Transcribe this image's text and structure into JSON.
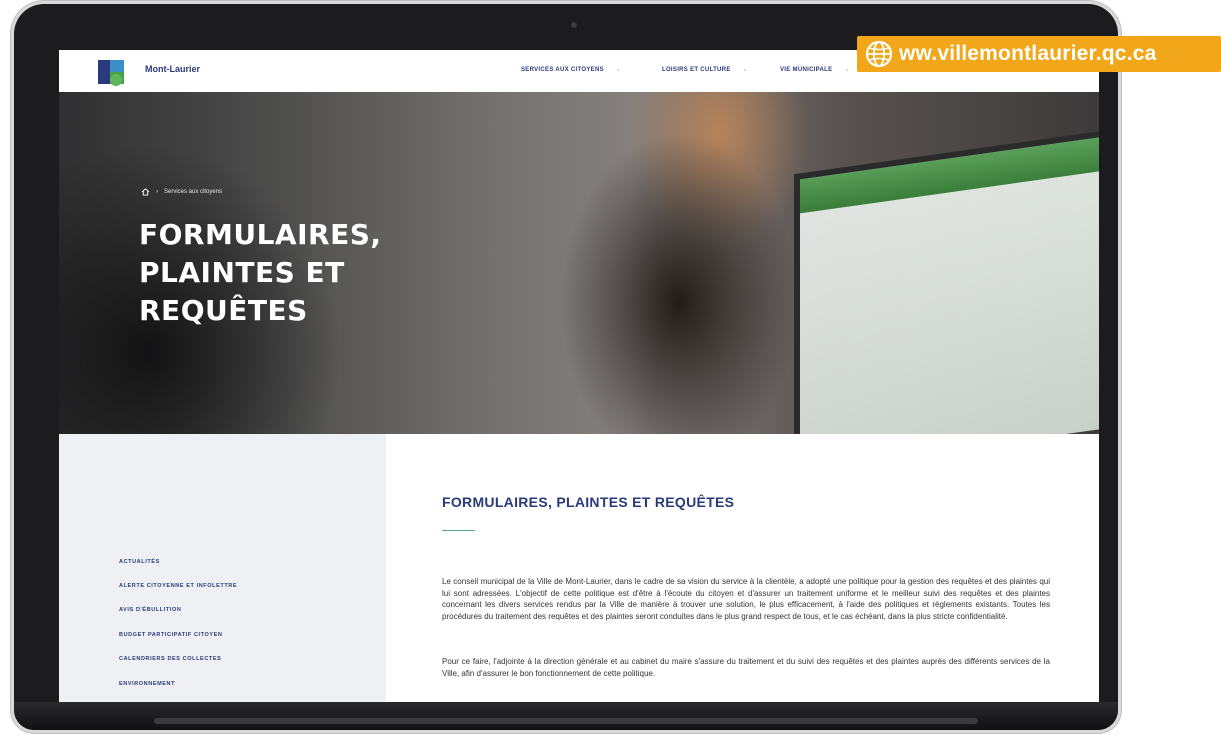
{
  "url_badge": {
    "text": "ww.villemontlaurier.qc.ca"
  },
  "site": {
    "brand": "Mont-Laurier",
    "nav": [
      {
        "label": "SERVICES AUX CITOYENS"
      },
      {
        "label": "LOISIRS ET CULTURE"
      },
      {
        "label": "VIE MUNICIPALE"
      }
    ]
  },
  "hero": {
    "breadcrumb": "Services aux citoyens",
    "title_lines": [
      "FORMULAIRES,",
      "PLAINTES ET",
      "REQUÊTES"
    ]
  },
  "sidebar": {
    "items": [
      {
        "label": "ACTUALITÉS"
      },
      {
        "label": "ALERTE CITOYENNE ET INFOLETTRE"
      },
      {
        "label": "AVIS D'ÉBULLITION"
      },
      {
        "label": "BUDGET PARTICIPATIF CITOYEN"
      },
      {
        "label": "CALENDRIERS DES COLLECTES"
      },
      {
        "label": "ENVIRONNEMENT"
      }
    ]
  },
  "content": {
    "title": "FORMULAIRES, PLAINTES ET REQUÊTES",
    "paragraphs": [
      "Le conseil municipal de la Ville de Mont-Laurier, dans le cadre de sa vision du service à la clientèle, a adopté une politique pour la gestion des requêtes et des plaintes qui lui sont adressées. L'objectif de cette politique est d'être à l'écoute du citoyen et d'assurer un traitement uniforme et le meilleur suivi des requêtes et des plaintes concernant les divers services rendus par la Ville de manière à trouver une solution, le plus efficacement, à l'aide des politiques et règlements existants. Toutes les procédures du traitement des requêtes et des plaintes seront conduites dans le plus grand respect de tous, et le cas échéant, dans la plus stricte confidentialité.",
      "Pour ce faire, l'adjointe à la direction générale et au cabinet du maire s'assure du traitement et du suivi des requêtes et des plaintes auprès des différents services de la Ville, afin d'assurer le bon fonctionnement de cette politique."
    ]
  },
  "colors": {
    "accent": "#f2a619",
    "brand_blue": "#2a3a7a",
    "rule_green": "#58a88a"
  },
  "icons": [
    "globe-icon",
    "home-icon",
    "chevron-down-icon",
    "city-logo"
  ]
}
